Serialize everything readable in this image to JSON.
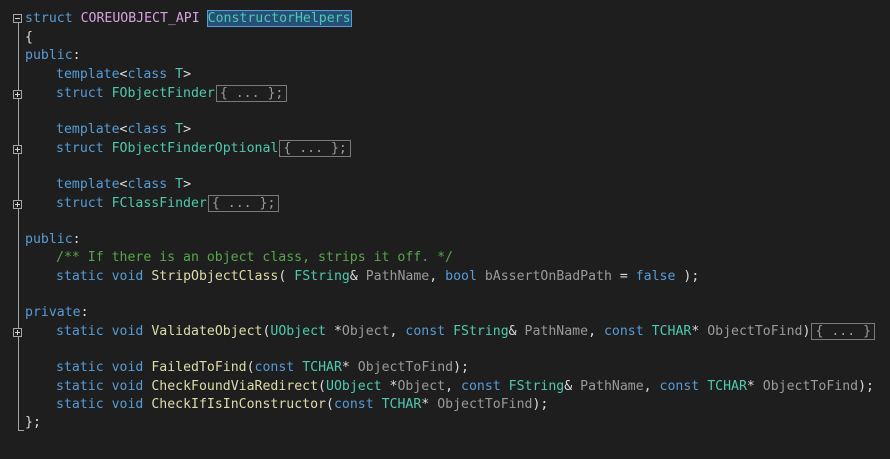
{
  "code": {
    "struct_kw": "struct",
    "api_macro": "COREUOBJECT_API",
    "class_name": "ConstructorHelpers",
    "open_brace": "{",
    "close_brace": "};",
    "public_kw": "public",
    "private_kw": "private",
    "colon": ":",
    "template_kw": "template",
    "class_kw": "class",
    "template_param": "T",
    "lt": "<",
    "gt": ">",
    "static_kw": "static",
    "void_kw": "void",
    "bool_kw": "bool",
    "const_kw": "const",
    "false_kw": "false",
    "finder": "FObjectFinder",
    "finder_optional": "FObjectFinderOptional",
    "class_finder": "FClassFinder",
    "collapsed_block": "{ ... };",
    "collapsed_block_fn": "{ ... }",
    "comment": "/** If there is an object class, strips it off. */",
    "strip_fn": "StripObjectClass",
    "validate_fn": "ValidateObject",
    "failed_fn": "FailedToFind",
    "check_redirect_fn": "CheckFoundViaRedirect",
    "check_ctor_fn": "CheckIfIsInConstructor",
    "fstring": "FString",
    "uobject": "UObject",
    "tchar": "TCHAR",
    "p_pathname": "PathName",
    "p_assert": "bAssertOnBadPath",
    "p_object": "Object",
    "p_objecttofind": "ObjectToFind"
  }
}
